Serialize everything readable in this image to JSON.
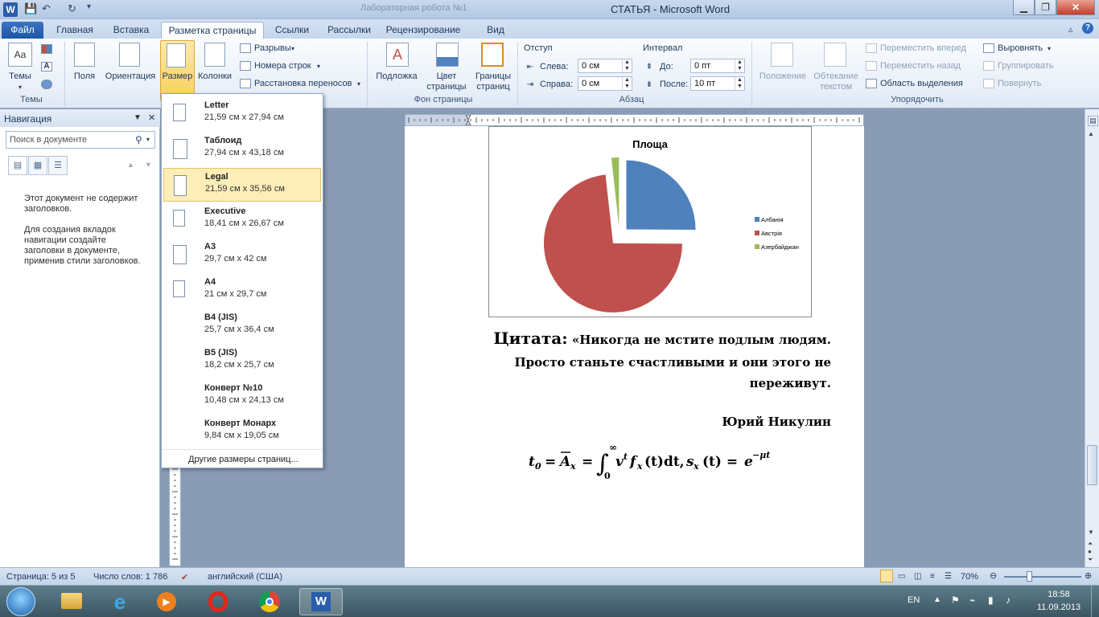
{
  "window": {
    "title": "СТАТЬЯ - Microsoft Word",
    "inactive_tab": "Лабораторная робота №1",
    "logo": "W"
  },
  "tabs": [
    "Файл",
    "Главная",
    "Вставка",
    "Разметка страницы",
    "Ссылки",
    "Рассылки",
    "Рецензирование",
    "Вид"
  ],
  "ribbon": {
    "themes": {
      "label": "Темы",
      "group": "Темы"
    },
    "page_setup": {
      "fields": "Поля",
      "orientation": "Ориентация",
      "size": "Размер",
      "columns": "Колонки",
      "breaks": "Разрывы",
      "line_numbers": "Номера строк",
      "hyphenation": "Расстановка переносов"
    },
    "page_bg": {
      "group": "Фон страницы",
      "watermark": "Подложка",
      "page_color_1": "Цвет",
      "page_color_2": "страницы",
      "borders_1": "Границы",
      "borders_2": "страниц"
    },
    "paragraph": {
      "group": "Абзац",
      "indent": "Отступ",
      "left": "Слева:",
      "right": "Справа:",
      "left_val": "0 см",
      "right_val": "0 см",
      "spacing": "Интервал",
      "before": "До:",
      "after": "После:",
      "before_val": "0 пт",
      "after_val": "10 пт"
    },
    "arrange": {
      "group": "Упорядочить",
      "position": "Положение",
      "wrap_1": "Обтекание",
      "wrap_2": "текстом",
      "bring_forward": "Переместить вперед",
      "send_backward": "Переместить назад",
      "selection_pane": "Область выделения",
      "align": "Выровнять",
      "group_btn": "Группировать",
      "rotate": "Повернуть"
    }
  },
  "nav": {
    "title": "Навигация",
    "search_placeholder": "Поиск в документе",
    "msg1": "Этот документ не содержит заголовков.",
    "msg2": "Для создания вкладок навигации создайте заголовки в документе, применив стили заголовков."
  },
  "size_menu": {
    "items": [
      {
        "name": "Letter",
        "dims": "21,59 см x 27,94 см"
      },
      {
        "name": "Таблоид",
        "dims": "27,94 см x 43,18 см"
      },
      {
        "name": "Legal",
        "dims": "21,59 см x 35,56 см"
      },
      {
        "name": "Executive",
        "dims": "18,41 см x 26,67 см"
      },
      {
        "name": "A3",
        "dims": "29,7 см x 42 см"
      },
      {
        "name": "A4",
        "dims": "21 см x 29,7 см"
      },
      {
        "name": "B4 (JIS)",
        "dims": "25,7 см x 36,4 см"
      },
      {
        "name": "B5 (JIS)",
        "dims": "18,2 см x 25,7 см"
      },
      {
        "name": "Конверт №10",
        "dims": "10,48 см x 24,13 см"
      },
      {
        "name": "Конверт Монарх",
        "dims": "9,84 см x 19,05 см"
      }
    ],
    "selected": "Legal",
    "more": "Другие размеры страниц..."
  },
  "chart_data": {
    "type": "pie",
    "title": "Площа",
    "categories": [
      "Албанія",
      "Австрія",
      "Азербайджан"
    ],
    "values": [
      28748,
      83871,
      2000
    ],
    "colors": [
      "#4f81bd",
      "#c0504d",
      "#9bbb59"
    ],
    "legend": "right",
    "exploded": true
  },
  "document": {
    "quote_label": "Цитата:",
    "quote_1": "«Никогда не мстите подлым людям.",
    "quote_2": "Просто станьте счастливыми и они этого не",
    "quote_3": "переживут.",
    "author": "Юрий Никулин"
  },
  "status": {
    "page": "Страница: 5 из 5",
    "words": "Число слов: 1 786",
    "lang": "английский (США)",
    "zoom": "70%"
  },
  "taskbar": {
    "lang": "EN",
    "time": "18:58",
    "date": "11.09.2013"
  }
}
